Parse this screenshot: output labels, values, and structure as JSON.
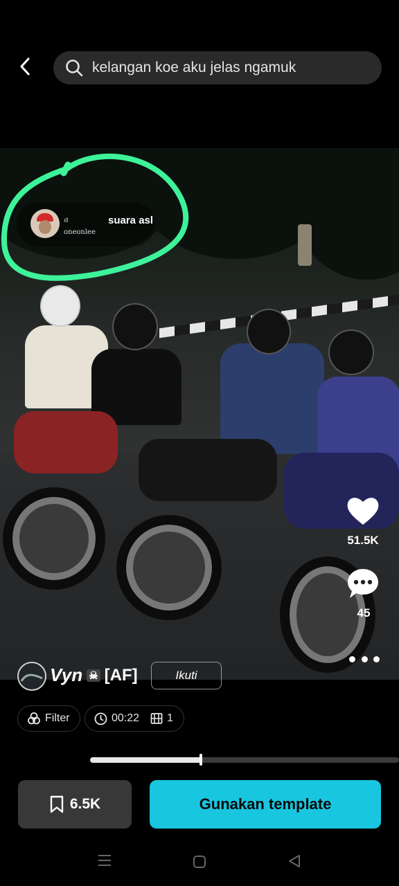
{
  "header": {
    "search_query": "kelangan koe aku jelas ngamuk"
  },
  "overlay": {
    "sound_label": "suara asl",
    "sound_user": "oneonlee",
    "signal_text": "ıll"
  },
  "actions": {
    "likes": "51.5K",
    "comments": "45"
  },
  "author": {
    "name": "Vyn",
    "skull": "☠",
    "tag": "[AF]",
    "follow_label": "Ikuti"
  },
  "chips": {
    "filter_label": "Filter",
    "duration": "00:22",
    "clip_count": "1"
  },
  "playback": {
    "progress_fraction": 0.36
  },
  "bottom": {
    "save_count": "6.5K",
    "use_template_label": "Gunakan template"
  },
  "colors": {
    "accent": "#18c6e0",
    "annotation_circle": "#3ef29a"
  }
}
